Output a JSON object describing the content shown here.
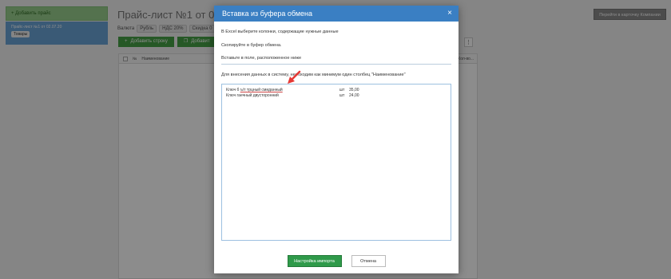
{
  "background": {
    "sidebar": {
      "add_label": "+ Добавить прайс",
      "item_label": "Прайс-лист №1 от 02.07.20",
      "item_badge": "Товары"
    },
    "page_title": "Прайс-лист №1 от 02.0",
    "meta": {
      "currency_label": "Валюта",
      "currency": "Рубль",
      "vat": "НДС 20%",
      "discount": "Скидка 0"
    },
    "company_button": "Перейти в карточку Компании",
    "toolbar": {
      "add_row": "Добавить строку",
      "add_other": "Добавит"
    },
    "table": {
      "col_num": "№",
      "col_name": "Наименование",
      "col_right": "Кол-во..."
    },
    "kebab": "⋮"
  },
  "modal": {
    "title": "Вставка из буфера обмена",
    "close_glyph": "×",
    "step1": "В Excel выберите колонки, содержащие нужные данные",
    "step2": "Скопируйте в буфер обмена.",
    "step3": "Вставьте в поле, расположенное ниже",
    "note": "Для внесения данных в систему, необходим как минимум один столбец \"Наименование\"",
    "paste_rows": [
      {
        "name_a": "Ключ б",
        "name_u": "ъ/т трцный смиданный",
        "unit": "шт",
        "price": "35,00"
      },
      {
        "name_a": "Ключ гаечный двусторонний",
        "name_u": "",
        "unit": "шт",
        "price": "24,00"
      }
    ],
    "import_button": "Настройка импорта",
    "cancel_button": "Отмена"
  },
  "colors": {
    "header_blue": "#3a7fc3",
    "primary_green": "#2f9a4a",
    "arrow_red": "#e53935"
  }
}
